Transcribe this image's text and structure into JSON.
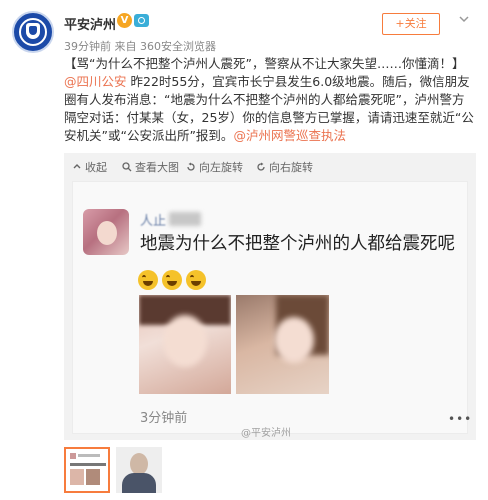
{
  "header": {
    "account_name": "平安泸州",
    "verified_badge": "V",
    "meta_time": "39分钟前",
    "meta_from": "来自",
    "meta_source": "360安全浏览器",
    "follow_label": "+关注"
  },
  "post": {
    "seg1": "【骂“为什么不把整个泸州人震死”，警察从不让大家失望……你懂滴！】",
    "mention": "@四川公安",
    "seg2": " 昨22时55分，宜宾市长宁县发生6.0级地震。随后，微信朋友圈有人发布消息：“地震为什么不把整个泸州的人都给震死呢”，泸州警方隔空对话：付某某（女，25岁）你的信息警方已掌握，请请迅速至就近“公安机关”或“公安派出所”报到。",
    "link": "@泸州网警巡查执法"
  },
  "media_toolbar": {
    "collect": "收起",
    "view_large": "查看大图",
    "rotate_left": "向左旋转",
    "rotate_right": "向右旋转"
  },
  "screenshot": {
    "poster_name": "人止",
    "text": "地震为什么不把整个泸州的人都给震死呢",
    "time": "3分钟前",
    "more": "•••"
  },
  "watermark": "@平安泸州",
  "colors": {
    "accent": "#eb7350",
    "follow": "#f77c3d",
    "badge": "#f6a623",
    "media_bg": "#f2f2f2"
  }
}
